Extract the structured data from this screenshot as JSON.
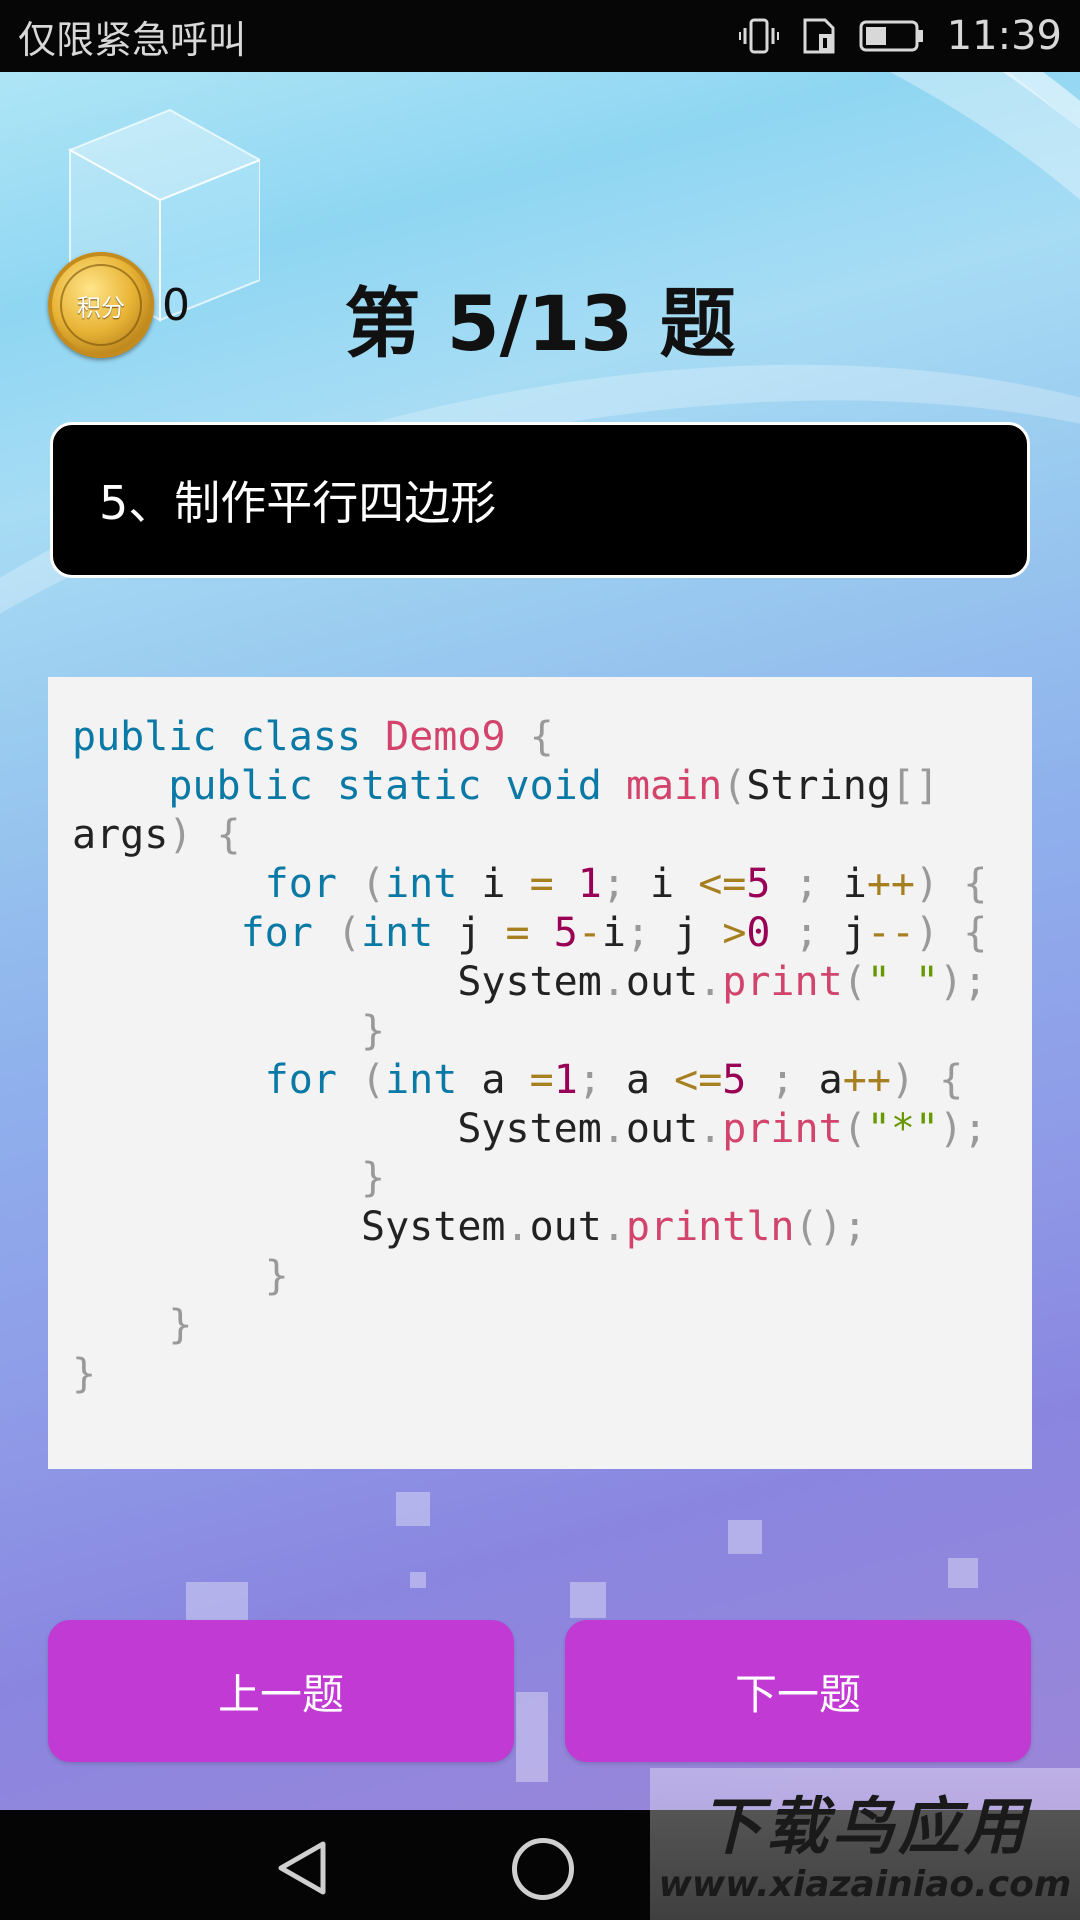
{
  "status_bar": {
    "carrier_text": "仅限紧急呼叫",
    "time": "11:39",
    "icons": [
      "vibrate-icon",
      "sim-card-icon",
      "battery-icon"
    ]
  },
  "header": {
    "coin_label": "积分",
    "score": "0",
    "question_counter": "第 5/13 题"
  },
  "question": {
    "title": "5、制作平行四边形"
  },
  "code": {
    "language": "java",
    "lines": [
      "public class Demo9 {",
      "    public static void main(String[]",
      "args) {",
      "        for (int i = 1; i <=5 ; i++) {",
      "       for (int j = 5-i; j >0 ; j--) {",
      "                System.out.print(\" \");",
      "            }",
      "        for (int a =1; a <=5 ; a++) {",
      "                System.out.print(\"*\");",
      "            }",
      "            System.out.println();",
      "        }",
      "    }",
      "}"
    ]
  },
  "buttons": {
    "prev_label": "上一题",
    "next_label": "下一题"
  },
  "navigation_bar": {
    "icons": [
      "back-icon",
      "home-icon"
    ]
  },
  "watermark": {
    "title": "下载鸟应用",
    "url": "www.xiazainiao.com"
  },
  "colors": {
    "button": "#c03ad3",
    "question_box": "#000000",
    "code_bg": "#f4f3f3",
    "keyword": "#0a79a5",
    "function": "#d2446b"
  }
}
